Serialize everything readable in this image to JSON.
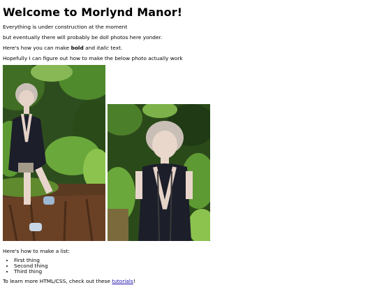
{
  "heading": "Welcome to Morlynd Manor!",
  "paragraphs": {
    "construction": "Everything is under construction at the moment",
    "doll_photos": "but eventually there will probably be doll photos here yonder.",
    "format_prefix": "Here's how you can make ",
    "format_bold": "bold",
    "format_middle": " and ",
    "format_italic": "italic",
    "format_suffix": " text.",
    "photo_note": "Hopefully I can figure out how to make the below photo actually work"
  },
  "list_section": {
    "intro": "Here's how to make a list:",
    "items": [
      "First thing",
      "Second thing",
      "Third thing"
    ]
  },
  "learn_more": {
    "prefix": "To learn more HTML/CSS, check out these ",
    "link_text": "tutorials",
    "suffix": "!"
  },
  "colors": {
    "link": "#1a0dab",
    "foliage_dark": "#1f3a14",
    "foliage_light": "#5e9a34",
    "dress": "#1c1e2a",
    "hair": "#c9bfb6"
  },
  "icons": [
    "doll-photo-standing",
    "doll-photo-portrait"
  ]
}
